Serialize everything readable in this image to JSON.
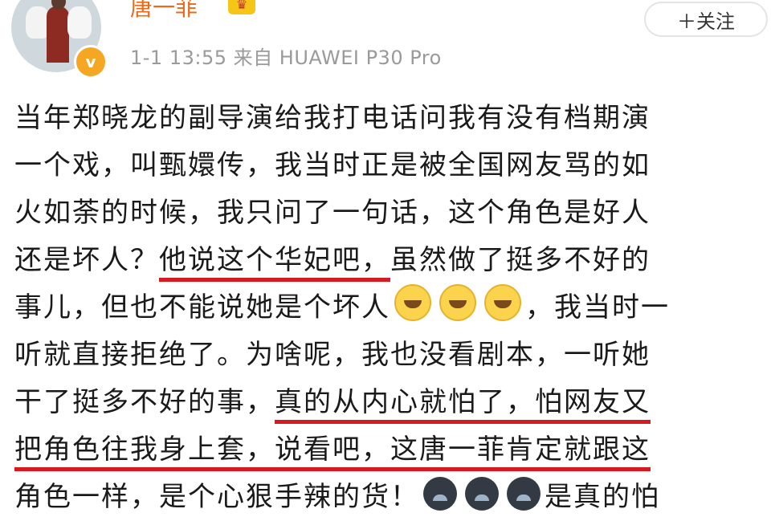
{
  "header": {
    "username": "唐一菲",
    "crown_icon": "crown-icon",
    "verified_icon": "verified-badge-icon",
    "timestamp": "1-1 13:55",
    "source": "来自 HUAWEI P30 Pro",
    "follow_label": "＋关注"
  },
  "post": {
    "line1": "当年郑晓龙的副导演给我打电话问我有没有档期演",
    "line2": "一个戏，叫甄嬛传，我当时正是被全国网友骂的如",
    "line3": "火如荼的时候，我只问了一句话，这个角色是好人",
    "line4a": "还是坏人？",
    "line4b": "他说这个华妃吧，",
    "line4c": "虽然做了挺多不好的",
    "line5a": "事儿，但也不能说她是个坏人",
    "line5b": "，我当时一",
    "line6": "听就直接拒绝了。为啥呢，我也没看剧本，一听她",
    "line7a": "干了挺多不好的事，",
    "line7b": "真的从内心就怕了，怕网友又",
    "line8a": "把角色往我身上套，说看吧，这唐一菲肯定就跟这",
    "line9a": "角色一样，是个心狠手辣的货！",
    "line9b": "是真的怕"
  },
  "colors": {
    "username": "#e86a1a",
    "highlight_underline": "#d71920",
    "meta_text": "#9a9a9a"
  }
}
